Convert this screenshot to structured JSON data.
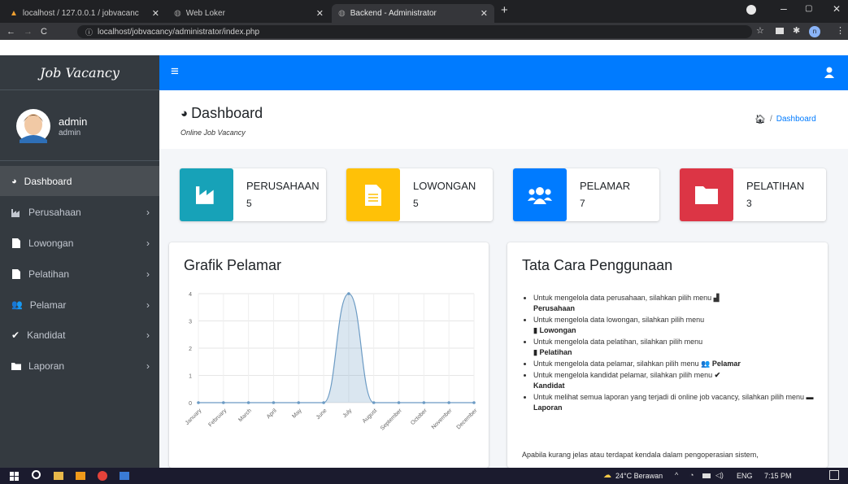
{
  "browser": {
    "tabs": [
      {
        "title": "localhost / 127.0.0.1 / jobvacanc",
        "active": false
      },
      {
        "title": "Web Loker",
        "active": false
      },
      {
        "title": "Backend - Administrator",
        "active": true
      }
    ],
    "new_tab_label": "+",
    "url": "localhost/jobvacancy/administrator/index.php"
  },
  "sidebar": {
    "brand": "Job Vacancy",
    "user": {
      "name": "admin",
      "role": "admin"
    },
    "items": [
      {
        "label": "Dashboard",
        "icon": "tachometer-icon",
        "active": true,
        "has_children": false
      },
      {
        "label": "Perusahaan",
        "icon": "industry-icon",
        "active": false,
        "has_children": true
      },
      {
        "label": "Lowongan",
        "icon": "file-icon",
        "active": false,
        "has_children": true
      },
      {
        "label": "Pelatihan",
        "icon": "file-icon",
        "active": false,
        "has_children": true
      },
      {
        "label": "Pelamar",
        "icon": "users-icon",
        "active": false,
        "has_children": true
      },
      {
        "label": "Kandidat",
        "icon": "check-icon",
        "active": false,
        "has_children": true
      },
      {
        "label": "Laporan",
        "icon": "folder-icon",
        "active": false,
        "has_children": true
      }
    ]
  },
  "header": {
    "title": "Dashboard",
    "subtitle": "Online Job Vacancy",
    "breadcrumb_current": "Dashboard",
    "breadcrumb_sep": "/"
  },
  "infoboxes": [
    {
      "label": "PERUSAHAAN",
      "value": "5",
      "color": "#17a2b8",
      "icon": "industry-icon"
    },
    {
      "label": "LOWONGAN",
      "value": "5",
      "color": "#ffc107",
      "icon": "file-icon"
    },
    {
      "label": "PELAMAR",
      "value": "7",
      "color": "#007bff",
      "icon": "users-icon"
    },
    {
      "label": "PELATIHAN",
      "value": "3",
      "color": "#dc3545",
      "icon": "folder-icon"
    }
  ],
  "chart_card": {
    "title": "Grafik Pelamar"
  },
  "chart_data": {
    "type": "area",
    "title": "Grafik Pelamar",
    "categories": [
      "January",
      "February",
      "March",
      "April",
      "May",
      "June",
      "July",
      "August",
      "September",
      "October",
      "November",
      "December"
    ],
    "values": [
      0,
      0,
      0,
      0,
      0,
      0,
      4,
      0,
      0,
      0,
      0,
      0
    ],
    "ylim": [
      0,
      4
    ],
    "yticks": [
      "0",
      "1",
      "2",
      "3",
      "4"
    ],
    "grid": true,
    "color": "#6c9bc4"
  },
  "howto_card": {
    "title": "Tata Cara Penggunaan",
    "items": [
      {
        "text": "Untuk mengelola data perusahaan, silahkan pilih menu",
        "menu": "Perusahaan"
      },
      {
        "text": "Untuk mengelola data lowongan, silahkan pilih menu",
        "menu": "Lowongan"
      },
      {
        "text": "Untuk mengelola data pelatihan, silahkan pilih menu",
        "menu": "Pelatihan"
      },
      {
        "text": "Untuk mengelola data pelamar, silahkan pilih menu",
        "menu": "Pelamar"
      },
      {
        "text": "Untuk mengelola kandidat pelamar, silahkan pilih menu",
        "menu": "Kandidat"
      },
      {
        "text": "Untuk melihat semua laporan yang terjadi di online job vacancy, silahkan pilih menu",
        "menu": "Laporan"
      }
    ],
    "footer_text": "Apabila kurang jelas atau terdapat kendala dalam pengoperasian sistem,"
  },
  "taskbar": {
    "weather": "24°C Berawan",
    "lang": "ENG",
    "time": "7:15 PM"
  }
}
